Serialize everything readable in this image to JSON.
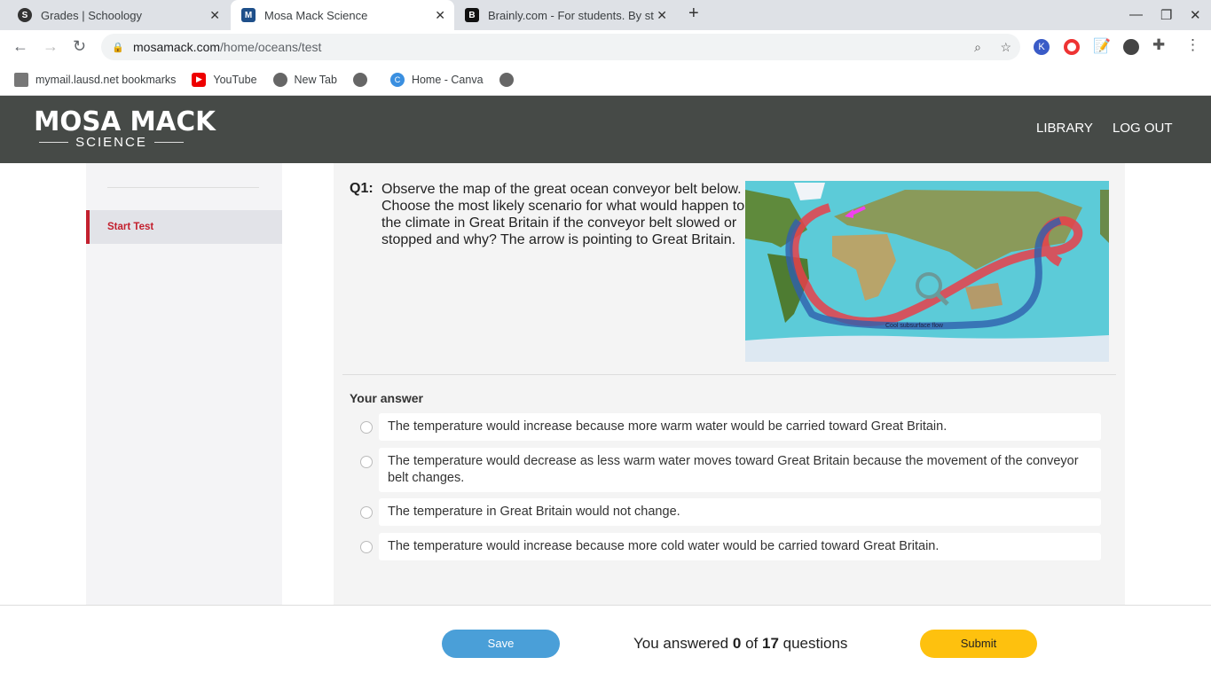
{
  "browser": {
    "tabs": [
      {
        "title": "Grades | Schoology",
        "icon": "schoology-icon"
      },
      {
        "title": "Mosa Mack Science",
        "icon": "mosa-mack-icon",
        "active": true
      },
      {
        "title": "Brainly.com - For students. By st",
        "icon": "brainly-icon"
      }
    ],
    "url_host": "mosamack.com",
    "url_path": "/home/oceans/test",
    "bookmarks": [
      {
        "label": "mymail.lausd.net bookmarks"
      },
      {
        "label": "YouTube"
      },
      {
        "label": "New Tab"
      },
      {
        "label": ""
      },
      {
        "label": "Home - Canva"
      },
      {
        "label": ""
      }
    ]
  },
  "site": {
    "logo_top": "MOSA MACK",
    "logo_bottom": "SCIENCE",
    "nav": {
      "library": "LIBRARY",
      "logout": "LOG OUT"
    }
  },
  "sidebar": {
    "items": [
      {
        "label": "Start Test",
        "active": true
      }
    ]
  },
  "question": {
    "number": "Q1:",
    "text": "Observe the map of the great ocean conveyor belt below. Choose the most likely scenario for what would happen to the climate in Great Britain if the conveyor belt slowed or stopped and why? The arrow is pointing to Great Britain.",
    "map_label": "Cool subsurface flow",
    "answer_label": "Your answer",
    "options": [
      "The temperature would increase because more warm water would be carried toward Great Britain.",
      "The temperature would decrease as less warm water moves toward Great Britain because the movement of the conveyor belt changes.",
      "The temperature in Great Britain would not change.",
      "The temperature would increase because more cold water would be carried toward Great Britain."
    ]
  },
  "footer": {
    "save": "Save",
    "submit": "Submit",
    "progress_prefix": "You answered",
    "answered": "0",
    "of": "of",
    "total": "17",
    "progress_suffix": "questions"
  },
  "colors": {
    "header": "#464a47",
    "accent_red": "#c3202e",
    "save": "#4a9fd8",
    "submit": "#fec10e"
  }
}
